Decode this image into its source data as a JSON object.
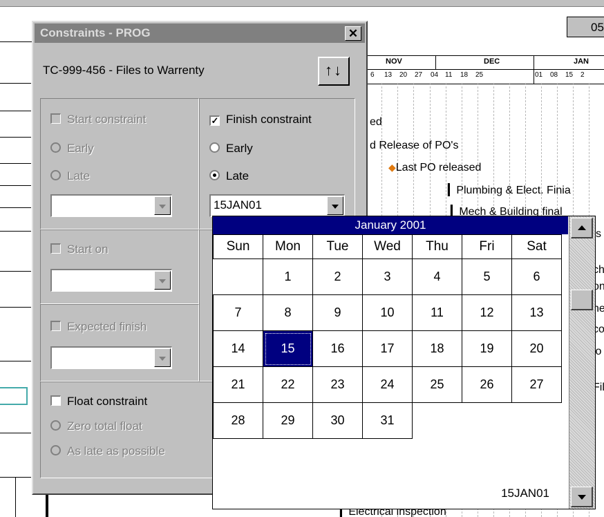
{
  "gantt": {
    "id_box": "05",
    "months": [
      "NOV",
      "DEC",
      "JAN"
    ],
    "weeks": [
      "6",
      "13",
      "20",
      "27",
      "04",
      "11",
      "18",
      "25",
      "01",
      "08",
      "15",
      "2"
    ],
    "tasks": [
      "ed",
      "d Release of PO's",
      "Last PO released",
      "Plumbing & Elect. Finia",
      "Mech & Building final",
      "s",
      "ch",
      "on",
      "ne",
      "co",
      "lo",
      "Fil",
      "Electrical inspection"
    ]
  },
  "dialog": {
    "title": "Constraints - PROG",
    "close": "✕",
    "task_name": "TC-999-456 - Files to Warrenty",
    "sort_icon": "↑↓",
    "start_constraint": {
      "label": "Start constraint",
      "early": "Early",
      "late": "Late",
      "value": ""
    },
    "finish_constraint": {
      "label": "Finish constraint",
      "checked": true,
      "early": "Early",
      "late": "Late",
      "selected": "Late",
      "value": "15JAN01"
    },
    "start_on": {
      "label": "Start on",
      "value": ""
    },
    "expected_finish": {
      "label": "Expected finish",
      "value": ""
    },
    "float_constraint": {
      "label": "Float constraint",
      "zero": "Zero total float",
      "alap": "As late as possible"
    }
  },
  "calendar": {
    "title": "January 2001",
    "days": [
      "Sun",
      "Mon",
      "Tue",
      "Wed",
      "Thu",
      "Fri",
      "Sat"
    ],
    "weeks": [
      [
        "",
        "1",
        "2",
        "3",
        "4",
        "5",
        "6"
      ],
      [
        "7",
        "8",
        "9",
        "10",
        "11",
        "12",
        "13"
      ],
      [
        "14",
        "15",
        "16",
        "17",
        "18",
        "19",
        "20"
      ],
      [
        "21",
        "22",
        "23",
        "24",
        "25",
        "26",
        "27"
      ],
      [
        "28",
        "29",
        "30",
        "31",
        "",
        "",
        ""
      ]
    ],
    "selected": "15",
    "footer": "15JAN01"
  },
  "icons": {
    "milestone": "diamond-icon",
    "close": "close-icon",
    "sort": "sort-arrows-icon"
  },
  "colors": {
    "title_active": "#000080",
    "dialog_face": "#c0c0c0",
    "milestone": "#e07a10"
  }
}
